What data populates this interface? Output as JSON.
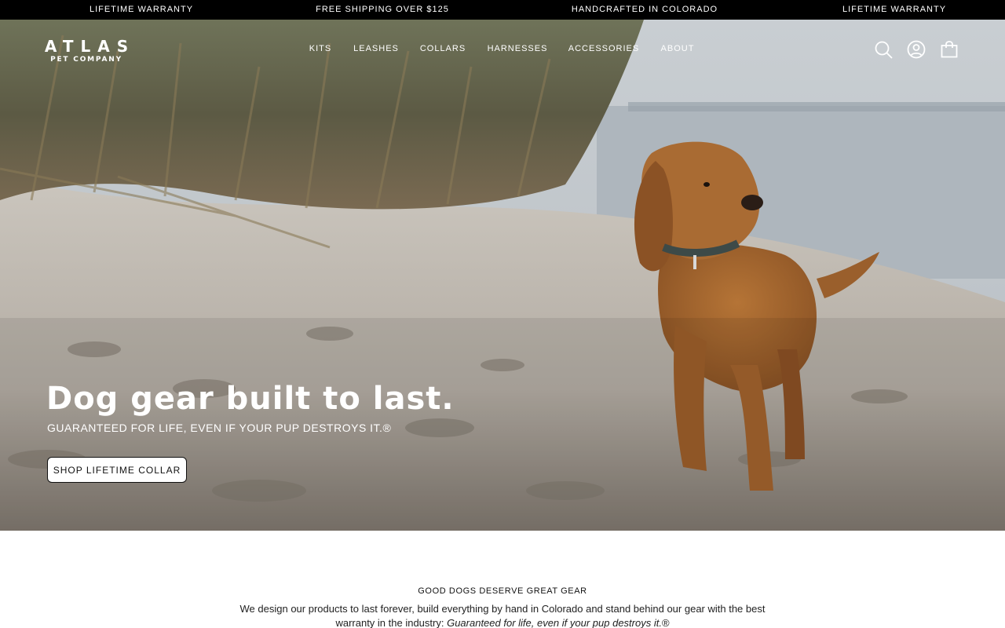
{
  "announcement": {
    "items": [
      "LIFETIME WARRANTY",
      "FREE SHIPPING OVER $125",
      "HANDCRAFTED IN COLORADO",
      "LIFETIME WARRANTY"
    ]
  },
  "header": {
    "logo_main": "ATLAS",
    "logo_sub": "PET COMPANY",
    "nav": [
      "KITS",
      "LEASHES",
      "COLLARS",
      "HARNESSES",
      "ACCESSORIES",
      "ABOUT"
    ],
    "icons": [
      "search-icon",
      "account-icon",
      "cart-icon"
    ]
  },
  "hero": {
    "title": "Dog gear built to last.",
    "subtitle": "GUARANTEED FOR LIFE, EVEN IF YOUR PUP DESTROYS IT.®",
    "button_label": "SHOP LIFETIME COLLAR"
  },
  "intro": {
    "kicker": "GOOD DOGS DESERVE GREAT GEAR",
    "body": "We design our products to last forever, build everything by hand in Colorado and stand behind our gear with the best warranty in the industry: ",
    "body_emphasis": "Guaranteed for life, even if your pup destroys it.",
    "body_mark": "®"
  },
  "colors": {
    "announce_bg": "#000000",
    "button_bg": "#ffffff",
    "text_dark": "#111111"
  }
}
